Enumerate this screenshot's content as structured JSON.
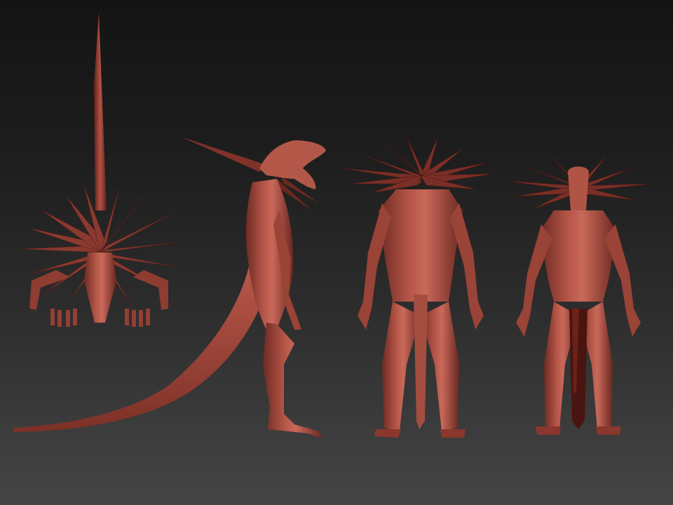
{
  "scene": {
    "colors": {
      "background_top": "#141414",
      "background_bottom": "#454545",
      "model_base": "#a8483d",
      "model_dark": "#5a1e18",
      "model_highlight": "#d67c6c",
      "tail_underside": "#4a1410"
    },
    "views": [
      {
        "name": "top-view"
      },
      {
        "name": "side-view"
      },
      {
        "name": "back-view"
      },
      {
        "name": "front-view"
      }
    ]
  }
}
